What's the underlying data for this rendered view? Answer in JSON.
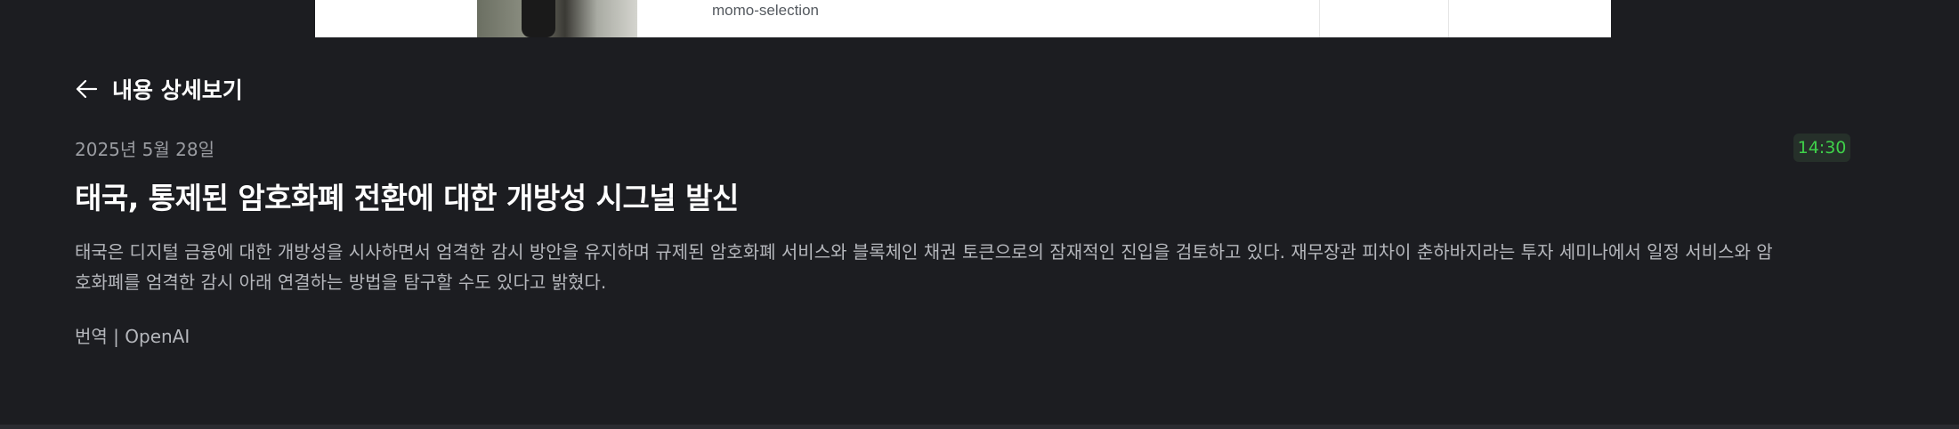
{
  "top_card": {
    "brand": "momo-selection"
  },
  "header": {
    "title": "내용 상세보기",
    "back_icon": "arrow-left-icon"
  },
  "article": {
    "date": "2025년 5월 28일",
    "time": "14:30",
    "headline": "태국, 통제된 암호화폐 전환에 대한 개방성 시그널 발신",
    "body_line1": "태국은 디지털 금융에 대한 개방성을 시사하면서 엄격한 감시 방안을 유지하며 규제된 암호화폐 서비스와 블록체인 채권 토큰으로의 잠재적인 진입을 검토하고 있다. 재무장관 피차이 춘하바지라는 투자 세미나에서 일정 서비스와 암",
    "body_line2": "호화폐를 엄격한 감시 아래 연결하는 방법을 탐구할 수도 있다고 밝혔다.",
    "source": "번역 | OpenAI"
  },
  "colors": {
    "background": "#1c1d21",
    "time_badge_text": "#3fd14a",
    "time_badge_bg": "#26302a"
  }
}
